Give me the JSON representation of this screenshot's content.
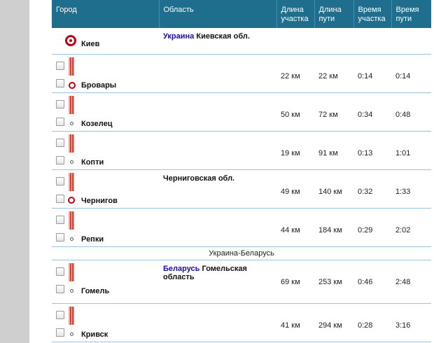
{
  "table": {
    "headers": {
      "city": "Город",
      "region": "Область",
      "segment_length": "Длина участка",
      "path_length": "Длина пути",
      "segment_time": "Время участка",
      "path_time": "Время пути"
    },
    "rows": [
      {
        "city": "Киев",
        "region_link": "Украина",
        "region_name": "Киевская обл.",
        "seg_len": "",
        "path_len": "",
        "seg_time": "",
        "path_time": ""
      },
      {
        "city": "Бровары",
        "region_link": "",
        "region_name": "",
        "seg_len": "22 км",
        "path_len": "22 км",
        "seg_time": "0:14",
        "path_time": "0:14"
      },
      {
        "city": "Козелец",
        "region_link": "",
        "region_name": "",
        "seg_len": "50 км",
        "path_len": "72 км",
        "seg_time": "0:34",
        "path_time": "0:48"
      },
      {
        "city": "Копти",
        "region_link": "",
        "region_name": "",
        "seg_len": "19 км",
        "path_len": "91 км",
        "seg_time": "0:13",
        "path_time": "1:01"
      },
      {
        "city": "Чернигов",
        "region_link": "",
        "region_name": "Черниговская обл.",
        "seg_len": "49 км",
        "path_len": "140 км",
        "seg_time": "0:32",
        "path_time": "1:33"
      },
      {
        "city": "Репки",
        "region_link": "",
        "region_name": "",
        "seg_len": "44 км",
        "path_len": "184 км",
        "seg_time": "0:29",
        "path_time": "2:02"
      },
      {
        "border": "Украина-Беларусь"
      },
      {
        "city": "Гомель",
        "region_link": "Беларусь",
        "region_name": "Гомельская область",
        "seg_len": "69 км",
        "path_len": "253 км",
        "seg_time": "0:46",
        "path_time": "2:48"
      },
      {
        "city": "Кривск",
        "region_link": "",
        "region_name": "",
        "seg_len": "41 км",
        "path_len": "294 км",
        "seg_time": "0:28",
        "path_time": "3:16"
      }
    ]
  }
}
